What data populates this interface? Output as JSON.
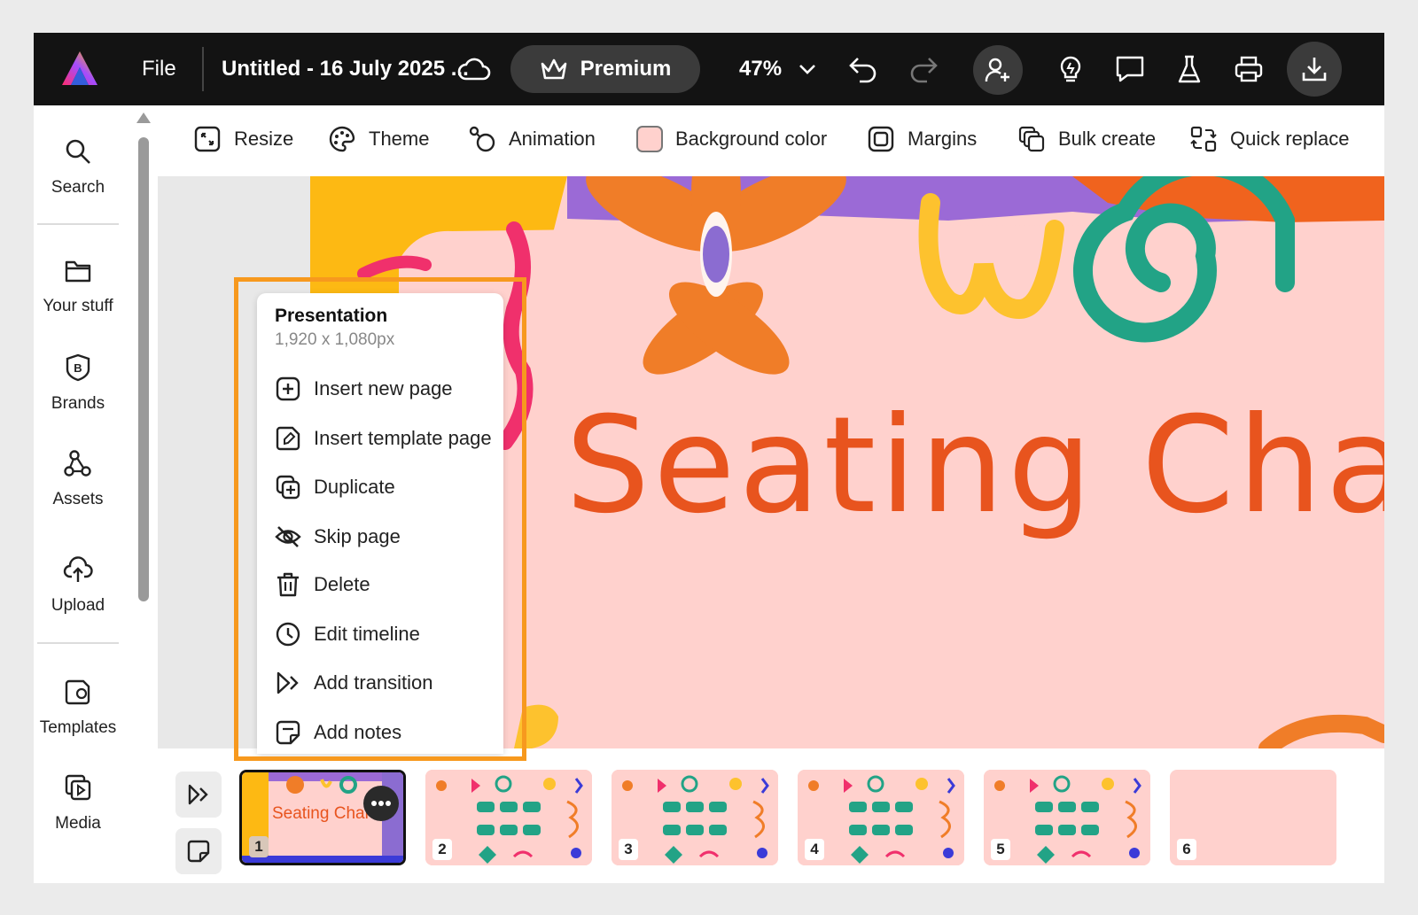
{
  "header": {
    "file_label": "File",
    "doc_title": "Untitled - 16 July 2025 ...",
    "premium_label": "Premium",
    "zoom": "47%"
  },
  "rail": {
    "items": [
      {
        "label": "Search",
        "icon": "search-icon"
      },
      {
        "label": "Your stuff",
        "icon": "folder-icon"
      },
      {
        "label": "Brands",
        "icon": "brand-icon"
      },
      {
        "label": "Assets",
        "icon": "assets-icon"
      },
      {
        "label": "Upload",
        "icon": "upload-cloud-icon"
      },
      {
        "label": "Templates",
        "icon": "templates-icon"
      },
      {
        "label": "Media",
        "icon": "media-icon"
      }
    ]
  },
  "toolbar": {
    "resize": "Resize",
    "theme": "Theme",
    "animation": "Animation",
    "background_color": "Background color",
    "margins": "Margins",
    "bulk_create": "Bulk create",
    "quick_replace": "Quick replace"
  },
  "slide": {
    "title": "Seating Char"
  },
  "menu": {
    "title": "Presentation",
    "subtitle": "1,920 x 1,080px",
    "items": [
      {
        "label": "Insert new page",
        "icon": "plus-square-icon"
      },
      {
        "label": "Insert template page",
        "icon": "template-page-icon"
      },
      {
        "label": "Duplicate",
        "icon": "duplicate-icon"
      },
      {
        "label": "Skip page",
        "icon": "eye-off-icon"
      },
      {
        "label": "Delete",
        "icon": "trash-icon"
      },
      {
        "label": "Edit timeline",
        "icon": "clock-icon"
      },
      {
        "label": "Add transition",
        "icon": "transition-icon"
      },
      {
        "label": "Add notes",
        "icon": "notes-icon"
      }
    ]
  },
  "pages": {
    "thumbs": [
      {
        "num": "1",
        "text": "Seating Char"
      },
      {
        "num": "2"
      },
      {
        "num": "3"
      },
      {
        "num": "4"
      },
      {
        "num": "5"
      },
      {
        "num": "6"
      }
    ]
  },
  "colors": {
    "accent_highlight": "#f7991e",
    "slide_bg": "#ffd1cd",
    "title_color": "#e8541e",
    "topbar_bg": "#131313"
  }
}
